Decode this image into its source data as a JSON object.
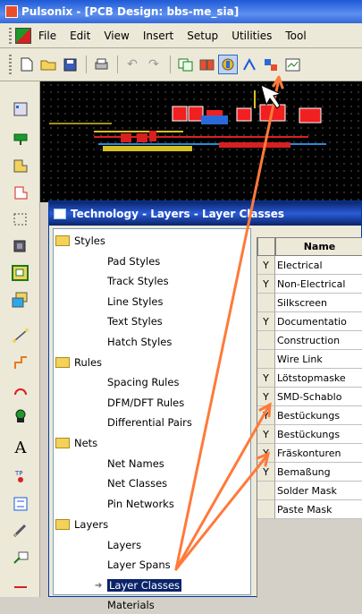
{
  "app": {
    "title": "Pulsonix - [PCB Design: bbs-me_sia]"
  },
  "menu": {
    "items": [
      "File",
      "Edit",
      "View",
      "Insert",
      "Setup",
      "Utilities",
      "Tool"
    ]
  },
  "dialog": {
    "title": "Technology - Layers - Layer Classes",
    "tree": [
      {
        "label": "Styles",
        "type": "folder"
      },
      {
        "label": "Pad Styles",
        "type": "leaf"
      },
      {
        "label": "Track Styles",
        "type": "leaf"
      },
      {
        "label": "Line Styles",
        "type": "leaf"
      },
      {
        "label": "Text Styles",
        "type": "leaf"
      },
      {
        "label": "Hatch Styles",
        "type": "leaf"
      },
      {
        "label": "Rules",
        "type": "folder"
      },
      {
        "label": "Spacing Rules",
        "type": "leaf"
      },
      {
        "label": "DFM/DFT Rules",
        "type": "leaf"
      },
      {
        "label": "Differential Pairs",
        "type": "leaf"
      },
      {
        "label": "Nets",
        "type": "folder"
      },
      {
        "label": "Net Names",
        "type": "leaf"
      },
      {
        "label": "Net Classes",
        "type": "leaf"
      },
      {
        "label": "Pin Networks",
        "type": "leaf"
      },
      {
        "label": "Layers",
        "type": "folder"
      },
      {
        "label": "Layers",
        "type": "leaf"
      },
      {
        "label": "Layer Spans",
        "type": "leaf"
      },
      {
        "label": "Layer Classes",
        "type": "leaf",
        "selected": true
      },
      {
        "label": "Materials",
        "type": "leaf"
      }
    ],
    "grid": {
      "header": "Name",
      "rows": [
        {
          "flag": "Y",
          "name": "Electrical"
        },
        {
          "flag": "Y",
          "name": "Non-Electrical"
        },
        {
          "flag": "",
          "name": "Silkscreen"
        },
        {
          "flag": "Y",
          "name": "Documentatio"
        },
        {
          "flag": "",
          "name": "Construction"
        },
        {
          "flag": "",
          "name": "Wire Link"
        },
        {
          "flag": "Y",
          "name": "Lötstopmaske"
        },
        {
          "flag": "Y",
          "name": "SMD-Schablo"
        },
        {
          "flag": "Y",
          "name": "Bestückungs"
        },
        {
          "flag": "Y",
          "name": "Bestückungs"
        },
        {
          "flag": "Y",
          "name": "Fräskonturen"
        },
        {
          "flag": "Y",
          "name": "Bemaßung"
        },
        {
          "flag": "",
          "name": "Solder Mask"
        },
        {
          "flag": "",
          "name": "Paste Mask"
        }
      ]
    }
  },
  "colors": {
    "annotation_arrow": "#ff7a3a",
    "canvas_bg": "#000000",
    "selection": "#0a246a"
  }
}
